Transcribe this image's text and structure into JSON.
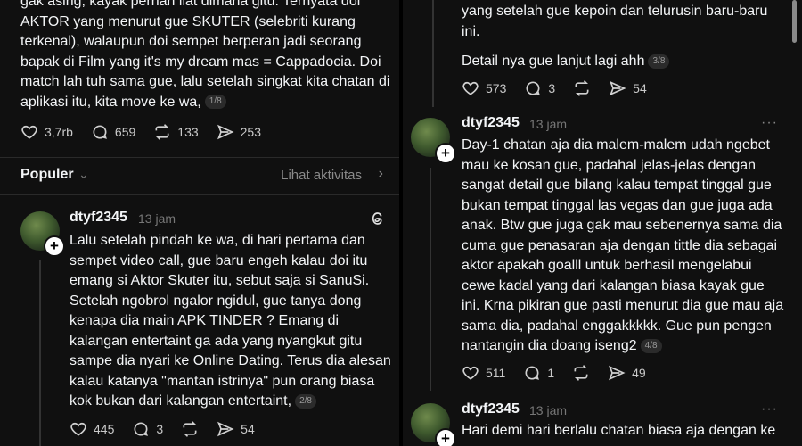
{
  "left_top_post": {
    "text": "gak asing, kayak pernah liat dimana gitu. Ternyata doi AKTOR yang menurut gue SKUTER (selebriti kurang terkenal), walaupun doi sempet berperan  jadi seorang bapak di Film yang it's my dream mas = Cappadocia. Doi match lah tuh sama gue, lalu setelah singkat kita chatan di aplikasi itu, kita move ke wa,",
    "badge": "1/8",
    "likes": "3,7rb",
    "replies": "659",
    "reposts": "133",
    "shares": "253"
  },
  "populer_bar": {
    "label": "Populer",
    "link": "Lihat aktivitas"
  },
  "left_post": {
    "username": "dtyf2345",
    "time": "13 jam",
    "text": "Lalu setelah pindah ke wa, di hari pertama dan sempet video call, gue baru engeh kalau doi itu emang si Aktor Skuter itu, sebut saja si SanuSi. Setelah ngobrol ngalor ngidul, gue tanya dong kenapa dia main APK TINDER ? Emang di kalangan entertaint ga ada yang nyangkut gitu sampe dia nyari ke Online Dating. Terus dia alesan kalau katanya \"mantan istrinya\" pun orang biasa kok bukan dari kalangan entertaint,",
    "badge": "2/8",
    "likes": "445",
    "replies": "3",
    "shares": "54"
  },
  "right_top_post": {
    "text": "yang setelah gue kepoin dan telurusin baru-baru ini.",
    "text2": "Detail nya gue lanjut lagi ahh",
    "badge": "3/8",
    "likes": "573",
    "replies": "3",
    "shares": "54"
  },
  "right_post_1": {
    "username": "dtyf2345",
    "time": "13 jam",
    "more": "···",
    "text": "Day-1 chatan aja dia malem-malem udah ngebet mau ke kosan gue, padahal jelas-jelas dengan sangat detail gue bilang kalau tempat tinggal gue bukan tempat tinggal las vegas dan gue juga ada anak. Btw gue juga gak mau sebenernya sama dia cuma gue penasaran aja dengan tittle dia sebagai aktor apakah goalll untuk berhasil mengelabui cewe kadal yang dari kalangan biasa kayak gue ini. Krna pikiran gue pasti menurut dia gue mau aja sama dia, padahal enggakkkkk. Gue pun pengen nantangin dia doang iseng2",
    "badge": "4/8",
    "likes": "511",
    "replies": "1",
    "shares": "49"
  },
  "right_post_2": {
    "username": "dtyf2345",
    "time": "13 jam",
    "more": "···",
    "text": "Hari demi hari berlalu chatan biasa aja dengan ke"
  },
  "icons": [
    "heart-icon",
    "reply-icon",
    "repost-icon",
    "share-icon",
    "threads-logo-icon",
    "plus-icon",
    "more-icon",
    "chevron-down-icon",
    "chevron-right-icon"
  ]
}
